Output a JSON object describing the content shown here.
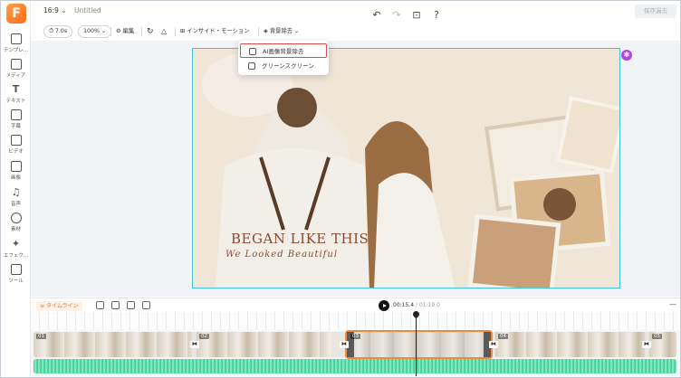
{
  "sidebar": {
    "logo": "F",
    "items": [
      {
        "label": "テンプレ..."
      },
      {
        "label": "メディア"
      },
      {
        "label": "テキスト"
      },
      {
        "label": "字幕"
      },
      {
        "label": "ビデオ"
      },
      {
        "label": "画像"
      },
      {
        "label": "音声"
      },
      {
        "label": "素材"
      },
      {
        "label": "エフェク..."
      },
      {
        "label": "ツール"
      }
    ]
  },
  "topbar": {
    "aspect_ratio": "16:9",
    "project_title": "Untitled",
    "export_label": "保存漏去"
  },
  "toolbar": {
    "duration": "7.0s",
    "zoom": "100%",
    "edit_label": "編集",
    "inside_motion_label": "インサイド・モーション",
    "bg_remove_label": "背景除去"
  },
  "dropdown": {
    "items": [
      {
        "label": "AI画像背景除去",
        "highlighted": true
      },
      {
        "label": "グリーンスクリーン",
        "highlighted": false
      }
    ]
  },
  "canvas": {
    "headline": "BEGAN LIKE THIS",
    "subline": "We Looked Beautiful"
  },
  "timeline": {
    "label": "タイムライン",
    "current_time": "00:15.4",
    "total_time": "/ 01:19.0",
    "clip_numbers": [
      "01",
      "02",
      "03",
      "04",
      "05"
    ]
  },
  "colors": {
    "brand": "#ff7a1a",
    "canvas_border": "#3ec6d6",
    "highlight_border": "#e04a4a",
    "audio": "#3fd29b"
  }
}
